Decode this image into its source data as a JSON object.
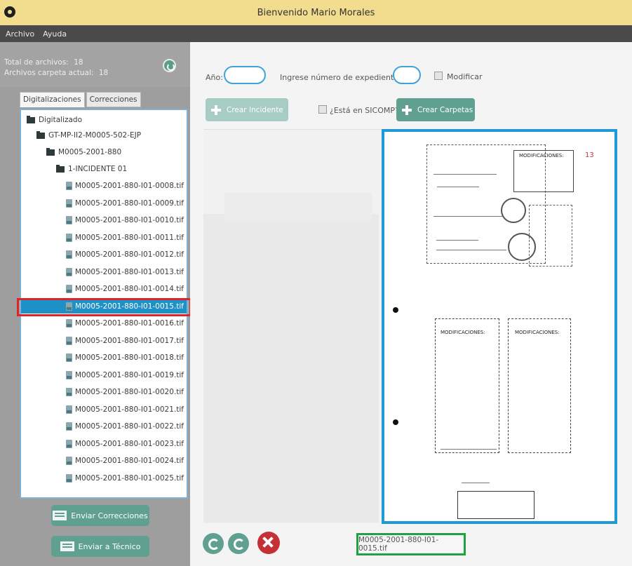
{
  "window": {
    "title": "Bienvenido Mario Morales"
  },
  "menu": {
    "items": [
      "Archivo",
      "Ayuda"
    ]
  },
  "stats": {
    "total_label": "Total de archivos:",
    "total_value": "18",
    "current_label": "Archivos carpeta actual:",
    "current_value": "18"
  },
  "tabs": [
    "Digitalizaciones",
    "Correcciones"
  ],
  "tree": {
    "root": "Digitalizado",
    "level1": "GT-MP-II2-M0005-502-EJP",
    "level2": "M0005-2001-880",
    "level3": "1-INCIDENTE 01",
    "files": [
      "M0005-2001-880-I01-0008.tif",
      "M0005-2001-880-I01-0009.tif",
      "M0005-2001-880-I01-0010.tif",
      "M0005-2001-880-I01-0011.tif",
      "M0005-2001-880-I01-0012.tif",
      "M0005-2001-880-I01-0013.tif",
      "M0005-2001-880-I01-0014.tif",
      "M0005-2001-880-I01-0015.tif",
      "M0005-2001-880-I01-0016.tif",
      "M0005-2001-880-I01-0017.tif",
      "M0005-2001-880-I01-0018.tif",
      "M0005-2001-880-I01-0019.tif",
      "M0005-2001-880-I01-0020.tif",
      "M0005-2001-880-I01-0021.tif",
      "M0005-2001-880-I01-0022.tif",
      "M0005-2001-880-I01-0023.tif",
      "M0005-2001-880-I01-0024.tif",
      "M0005-2001-880-I01-0025.tif"
    ],
    "selected_index": 7
  },
  "side_buttons": {
    "send_corrections": "Enviar Correcciones",
    "send_technician": "Enviar a Técnico"
  },
  "form": {
    "year_label": "Año:",
    "year_value": "",
    "expediente_label": "Ingrese número de expediente:",
    "expediente_value": "",
    "modify_label": "Modificar",
    "create_incident": "Crear Incidente",
    "sicomp_label": "¿Está en SICOMP?",
    "create_folders": "Crear Carpetas"
  },
  "document": {
    "stamp1": "MODIFICACIONES:",
    "stamp2": "MODIFICACIONES:",
    "stamp3": "MODIFICACIONES:",
    "page_mark": "13"
  },
  "current_file": "M0005-2001-880-I01-0015.tif",
  "colors": {
    "titlebar": "#f2dd8e",
    "menubar": "#4a4a4a",
    "accent_green": "#5fa090",
    "selection_blue": "#1e90c8",
    "delete_red": "#c62f35"
  }
}
